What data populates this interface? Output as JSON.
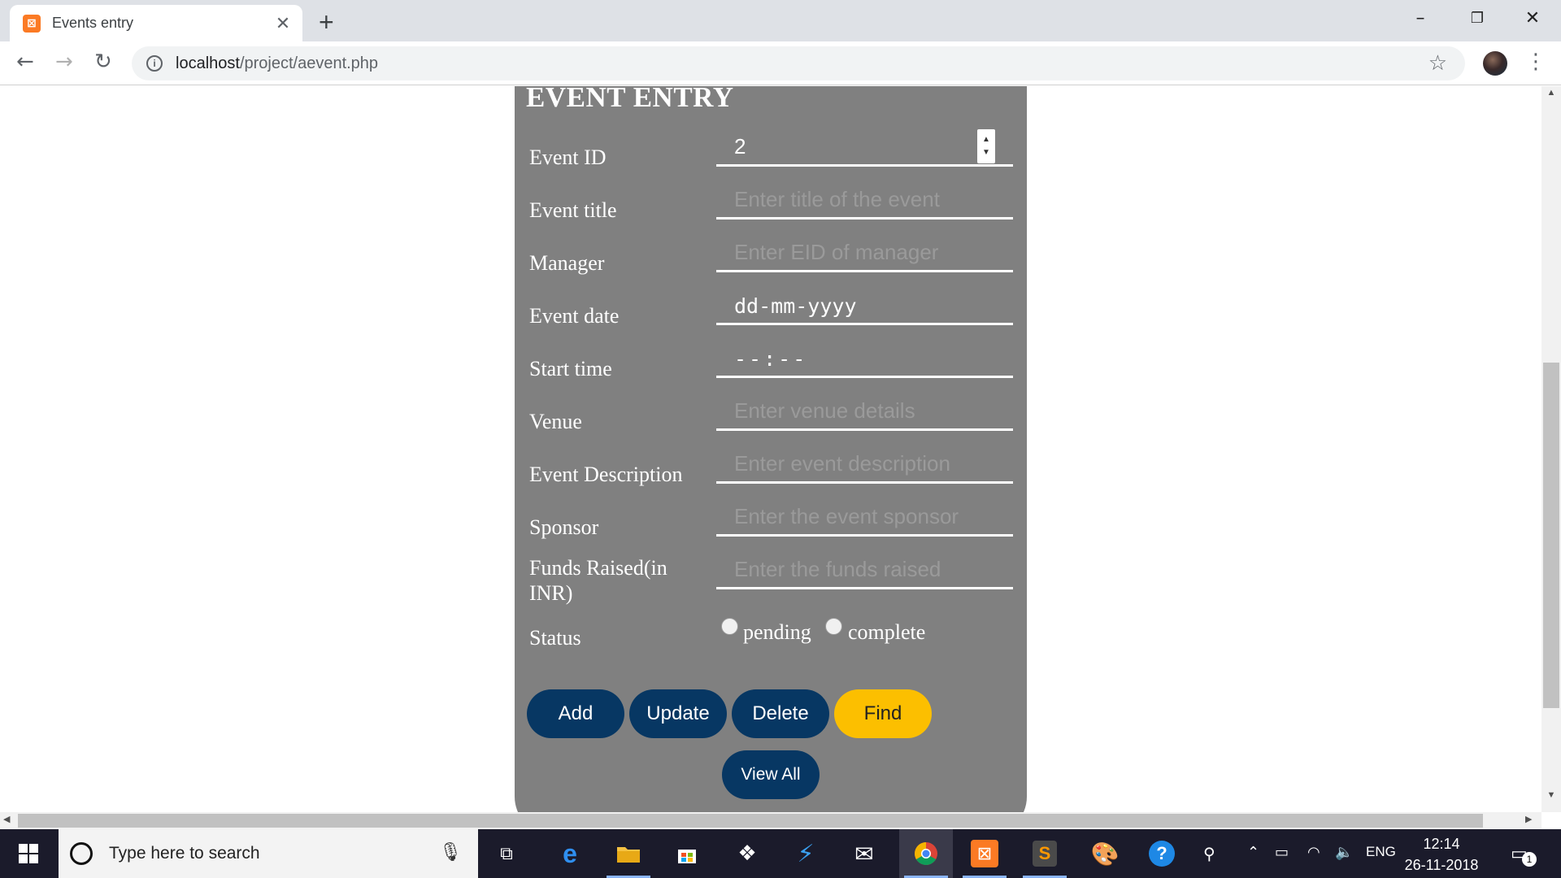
{
  "browser": {
    "tab_title": "Events entry",
    "tab_favicon": "xampp-icon",
    "url_host": "localhost",
    "url_path": "/project/aevent.php"
  },
  "form": {
    "title": "EVENT ENTRY",
    "rows": [
      {
        "label": "Event ID",
        "value": "2",
        "placeholder": ""
      },
      {
        "label": "Event title",
        "value": "",
        "placeholder": "Enter title of the event"
      },
      {
        "label": "Manager",
        "value": "",
        "placeholder": "Enter EID of manager"
      },
      {
        "label": "Event date",
        "value": "dd-mm-yyyy",
        "placeholder": ""
      },
      {
        "label": "Start time",
        "value": "--:--",
        "placeholder": ""
      },
      {
        "label": "Venue",
        "value": "",
        "placeholder": "Enter venue details"
      },
      {
        "label": "Event Description",
        "value": "",
        "placeholder": "Enter event description"
      },
      {
        "label": "Sponsor",
        "value": "",
        "placeholder": "Enter the event sponsor"
      },
      {
        "label": "Funds Raised(in INR)",
        "value": "",
        "placeholder": "Enter the funds raised"
      },
      {
        "label": "Status",
        "value": "",
        "placeholder": ""
      }
    ],
    "status_options": [
      "pending",
      "complete"
    ],
    "buttons": {
      "add": "Add",
      "update": "Update",
      "delete": "Delete",
      "find": "Find",
      "view_all": "View All"
    },
    "colors": {
      "panel": "#808080",
      "button": "#073763",
      "find_button": "#fcbf00"
    }
  },
  "taskbar": {
    "search_placeholder": "Type here to search",
    "language": "ENG",
    "time": "12:14",
    "date": "26-11-2018",
    "notification_count": "1"
  }
}
